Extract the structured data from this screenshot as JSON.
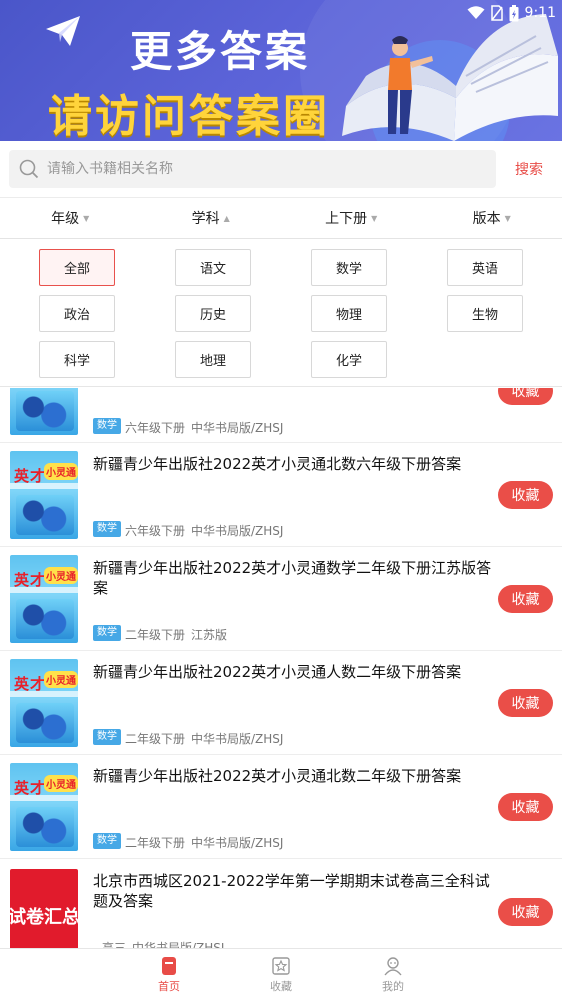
{
  "status_bar": {
    "time": "9:11"
  },
  "banner": {
    "title": "更多答案",
    "subtitle": "请访问答案圈"
  },
  "search": {
    "placeholder": "请输入书籍相关名称",
    "value": "",
    "button_label": "搜索"
  },
  "filters": [
    {
      "label": "年级",
      "caret": "▼"
    },
    {
      "label": "学科",
      "caret": "▲"
    },
    {
      "label": "上下册",
      "caret": "▼"
    },
    {
      "label": "版本",
      "caret": "▼"
    }
  ],
  "subjects": [
    "全部",
    "语文",
    "数学",
    "英语",
    "政治",
    "历史",
    "物理",
    "生物",
    "科学",
    "地理",
    "化学"
  ],
  "selected_subject": "全部",
  "list_items": [
    {
      "title": "",
      "badge": "数学",
      "grade": "六年级下册",
      "edition": "中华书局版/ZHSJ",
      "button": "收藏"
    },
    {
      "title": "新疆青少年出版社2022英才小灵通北数六年级下册答案",
      "badge": "数学",
      "grade": "六年级下册",
      "edition": "中华书局版/ZHSJ",
      "button": "收藏"
    },
    {
      "title": "新疆青少年出版社2022英才小灵通数学二年级下册江苏版答案",
      "badge": "数学",
      "grade": "二年级下册",
      "edition": "江苏版",
      "button": "收藏"
    },
    {
      "title": "新疆青少年出版社2022英才小灵通人数二年级下册答案",
      "badge": "数学",
      "grade": "二年级下册",
      "edition": "中华书局版/ZHSJ",
      "button": "收藏"
    },
    {
      "title": "新疆青少年出版社2022英才小灵通北数二年级下册答案",
      "badge": "数学",
      "grade": "二年级下册",
      "edition": "中华书局版/ZHSJ",
      "button": "收藏"
    },
    {
      "title": "北京市西城区2021-2022学年第一学期期末试卷高三全科试题及答案",
      "badge": "",
      "grade": "高三",
      "edition": "中华书局版/ZHSJ",
      "button": "收藏"
    }
  ],
  "cover": {
    "series_title": "英才",
    "series_tag": "小灵通",
    "exam_title": "试卷汇总"
  },
  "bottom_nav": [
    {
      "label": "首页",
      "icon": "home-icon",
      "active": true
    },
    {
      "label": "收藏",
      "icon": "star-icon",
      "active": false
    },
    {
      "label": "我的",
      "icon": "user-icon",
      "active": false
    }
  ],
  "colors": {
    "accent": "#e84c47",
    "banner": "#5b63d8",
    "badge": "#46a8e6",
    "banner_subtitle": "#ffd43b"
  }
}
